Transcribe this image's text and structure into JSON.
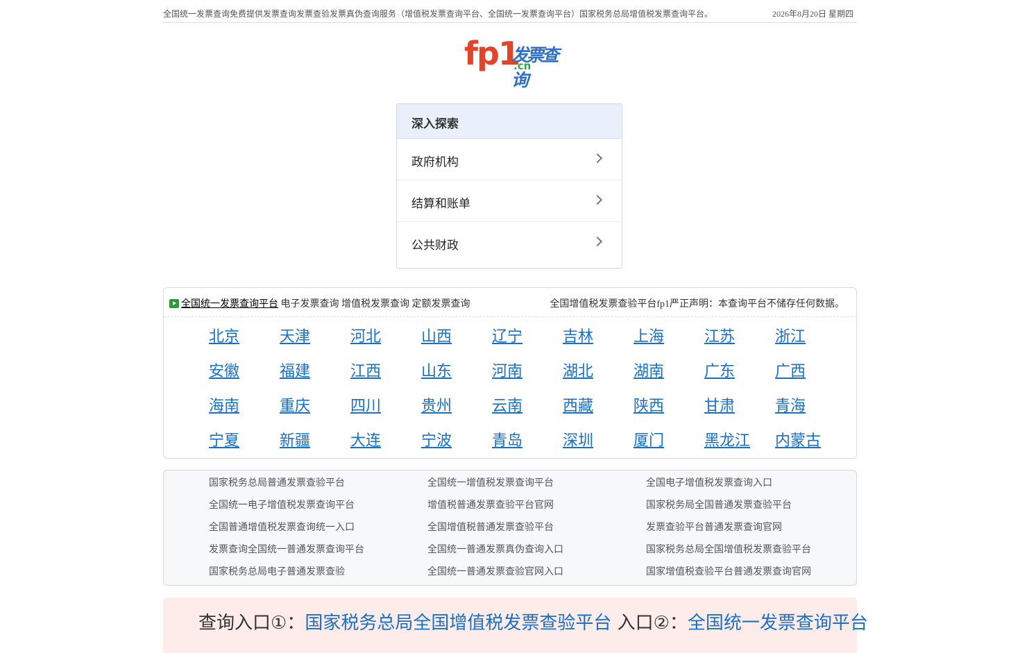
{
  "topbar": {
    "description": "全国统一发票查询免费提供发票查询发票查验发票真伪查询服务（增值税发票查询平台、全国统一发票查询平台）国家税务总局增值税发票查询平台。",
    "date": "2026年8月20日 星期四"
  },
  "logo": {
    "main": "fp1",
    "title": "发票查询",
    "suffix": ".cn",
    "colors": {
      "main": "#e0452b",
      "title": "#2f6fc6",
      "suffix": "#2fa84f"
    }
  },
  "explore": {
    "heading": "深入探索",
    "items": [
      {
        "label": "政府机构"
      },
      {
        "label": "结算和账单"
      },
      {
        "label": "公共财政"
      }
    ]
  },
  "notice": {
    "platform_link": "全国统一发票查询平台",
    "links_text": " 电子发票查询 增值税发票查询 定额发票查询",
    "statement": "全国增值税发票查验平台fp1严正声明：本查询平台不储存任何数据。"
  },
  "regions": [
    "北京",
    "天津",
    "河北",
    "山西",
    "辽宁",
    "吉林",
    "上海",
    "江苏",
    "浙江",
    "安徽",
    "福建",
    "江西",
    "山东",
    "河南",
    "湖北",
    "湖南",
    "广东",
    "广西",
    "海南",
    "重庆",
    "四川",
    "贵州",
    "云南",
    "西藏",
    "陕西",
    "甘肃",
    "青海",
    "宁夏",
    "新疆",
    "大连",
    "宁波",
    "青岛",
    "深圳",
    "厦门",
    "黑龙江",
    "内蒙古"
  ],
  "links": [
    "国家税务总局普通发票查验平台",
    "全国统一增值税发票查询平台",
    "全国电子增值税发票查询入口",
    "全国统一电子增值税发票查询平台",
    "增值税普通发票查验平台官网",
    "国家税务局全国普通发票查验平台",
    "全国普通增值税发票查询统一入口",
    "全国增值税普通发票查验平台",
    "发票查验平台普通发票查询官网",
    "发票查询全国统一普通发票查询平台",
    "全国统一普通发票真伪查询入口",
    "国家税务总局全国增值税发票查验平台",
    "国家税务总局电子普通发票查验",
    "全国统一普通发票查验官网入口",
    "国家增值税查验平台普通发票查询官网"
  ],
  "entry": {
    "label1": "查询入口①：",
    "link1": "国家税务总局全国增值税发票查验平台",
    "label2": " 入口②：",
    "link2": "全国统一发票查询平台"
  }
}
